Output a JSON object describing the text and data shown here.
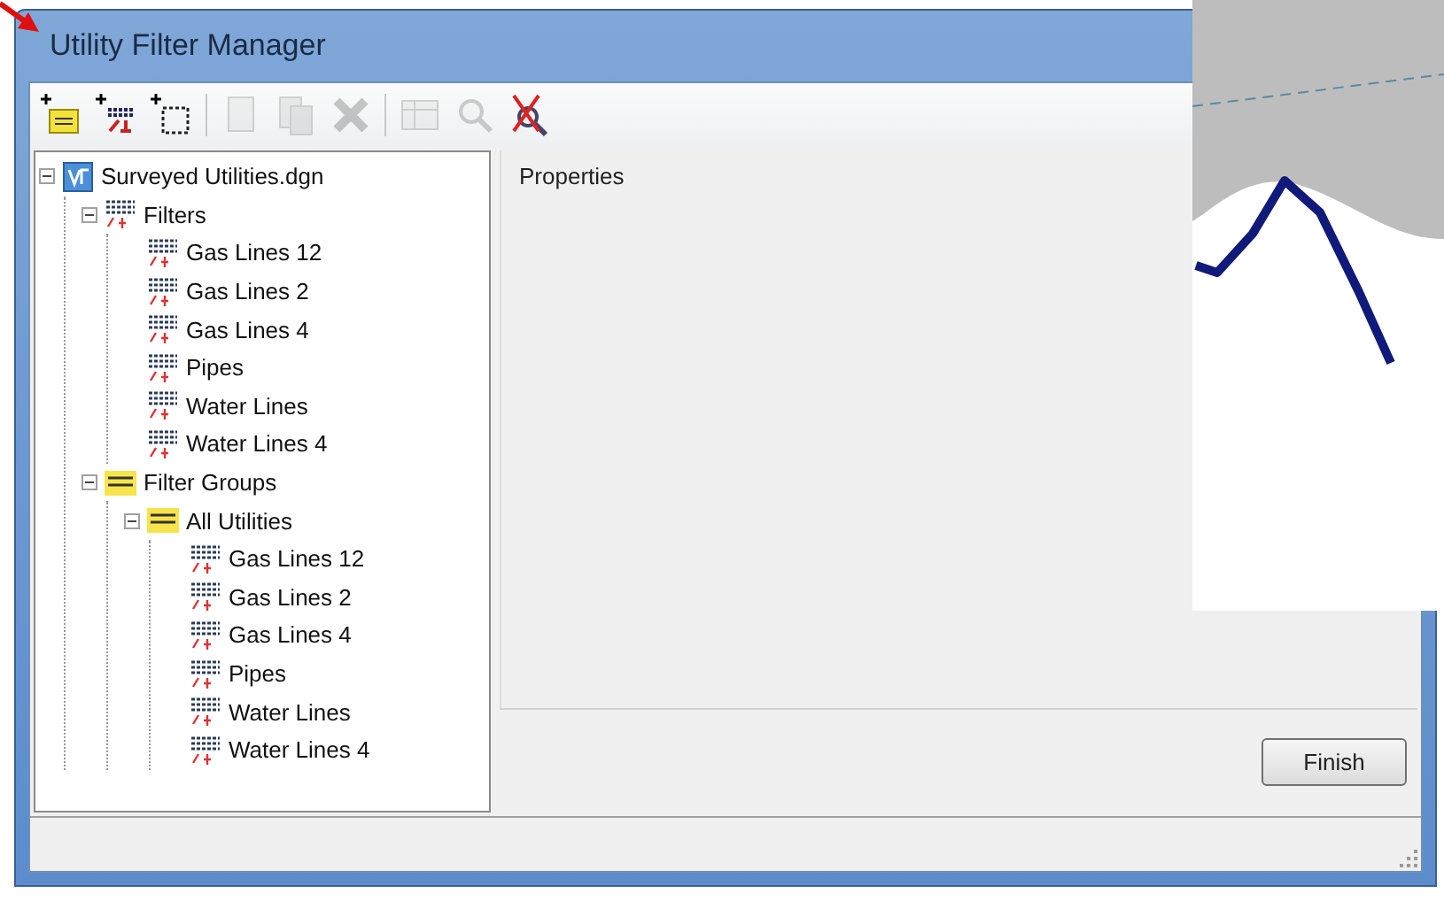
{
  "window": {
    "title": "Utility Filter Manager"
  },
  "toolbar": [
    {
      "kind": "add-group",
      "disabled": false
    },
    {
      "kind": "add-filter",
      "disabled": false
    },
    {
      "kind": "add-selection",
      "disabled": false
    },
    {
      "kind": "sep"
    },
    {
      "kind": "copy",
      "disabled": true
    },
    {
      "kind": "paste",
      "disabled": true
    },
    {
      "kind": "delete",
      "disabled": true
    },
    {
      "kind": "sep"
    },
    {
      "kind": "table",
      "disabled": true
    },
    {
      "kind": "find",
      "disabled": true
    },
    {
      "kind": "clear-find",
      "disabled": false
    }
  ],
  "tree": [
    {
      "label": "Surveyed Utilities.dgn",
      "kind": "file",
      "expanded": true,
      "children": [
        {
          "label": "Filters",
          "kind": "filter",
          "expanded": true,
          "children": [
            {
              "label": "Gas Lines 12",
              "kind": "filter"
            },
            {
              "label": "Gas Lines 2",
              "kind": "filter"
            },
            {
              "label": "Gas Lines 4",
              "kind": "filter"
            },
            {
              "label": "Pipes",
              "kind": "filter"
            },
            {
              "label": "Water Lines",
              "kind": "filter"
            },
            {
              "label": "Water Lines 4",
              "kind": "filter"
            }
          ]
        },
        {
          "label": "Filter Groups",
          "kind": "group",
          "expanded": true,
          "children": [
            {
              "label": "All Utilities",
              "kind": "group",
              "expanded": true,
              "children": [
                {
                  "label": "Gas Lines 12",
                  "kind": "filter"
                },
                {
                  "label": "Gas Lines 2",
                  "kind": "filter"
                },
                {
                  "label": "Gas Lines 4",
                  "kind": "filter"
                },
                {
                  "label": "Pipes",
                  "kind": "filter"
                },
                {
                  "label": "Water Lines",
                  "kind": "filter"
                },
                {
                  "label": "Water Lines 4",
                  "kind": "filter"
                }
              ]
            }
          ]
        }
      ]
    }
  ],
  "properties": {
    "title": "Properties"
  },
  "buttons": [
    "Finish"
  ]
}
